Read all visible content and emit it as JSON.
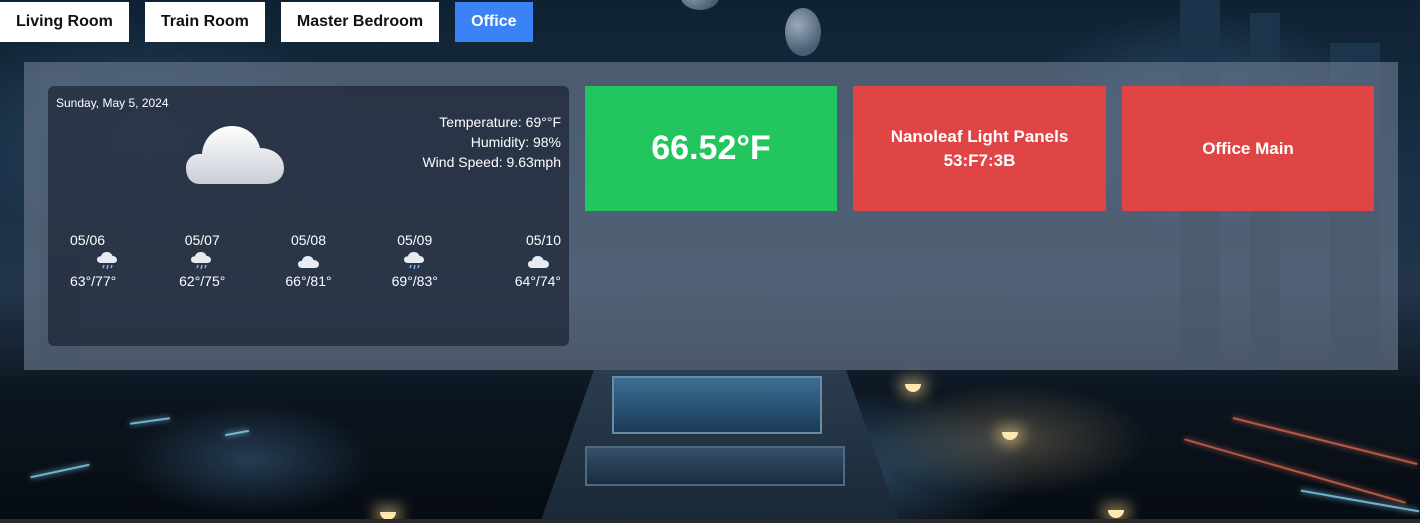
{
  "tabs": [
    {
      "label": "Living Room",
      "active": false
    },
    {
      "label": "Train Room",
      "active": false
    },
    {
      "label": "Master Bedroom",
      "active": false
    },
    {
      "label": "Office",
      "active": true
    }
  ],
  "weather": {
    "date": "Sunday, May 5, 2024",
    "current_icon": "cloud-icon",
    "temperature": "Temperature: 69°°F",
    "humidity": "Humidity: 98%",
    "wind_speed": "Wind Speed: 9.63mph",
    "forecast": [
      {
        "date": "05/06",
        "icon": "rain-cloud-icon",
        "range": "63°/77°"
      },
      {
        "date": "05/07",
        "icon": "rain-cloud-icon",
        "range": "62°/75°"
      },
      {
        "date": "05/08",
        "icon": "cloud-icon",
        "range": "66°/81°"
      },
      {
        "date": "05/09",
        "icon": "rain-cloud-icon",
        "range": "69°/83°"
      },
      {
        "date": "05/10",
        "icon": "cloud-icon",
        "range": "64°/74°"
      }
    ]
  },
  "tiles": {
    "temperature": {
      "value": "66.52°F",
      "color": "#22c55e"
    },
    "light_panels": {
      "name": "Nanoleaf Light Panels",
      "id": "53:F7:3B",
      "color": "#e04545"
    },
    "office_main": {
      "name": "Office Main",
      "color": "#e04545"
    }
  },
  "colors": {
    "active_tab": "#3b82f6",
    "tab": "#ffffff"
  }
}
